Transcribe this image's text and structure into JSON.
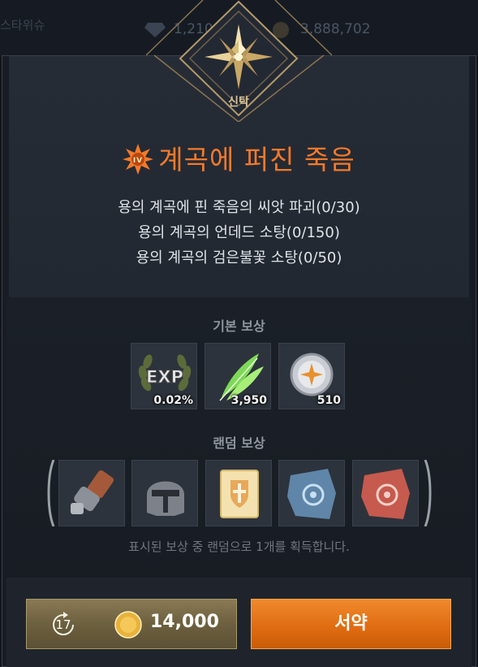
{
  "currency": {
    "left_label": "스타위슈",
    "gems": "1,210",
    "coins": "3,888,702"
  },
  "emblem": {
    "label": "신탁"
  },
  "quest": {
    "title": "계곡에 퍼진 죽음",
    "objectives": [
      "용의 계곡에 핀 죽음의 씨앗 파괴(0/30)",
      "용의 계곡의 언데드 소탕(0/150)",
      "용의 계곡의 검은불꽃 소탕(0/50)"
    ]
  },
  "rewards": {
    "basic_title": "기본 보상",
    "basic_items": [
      {
        "icon": "exp-icon",
        "text": "EXP",
        "qty": "0.02%"
      },
      {
        "icon": "feather-icon",
        "qty": "3,950"
      },
      {
        "icon": "medal-icon",
        "qty": "510"
      }
    ],
    "random_title": "랜덤 보상",
    "random_items": [
      {
        "icon": "gauntlet-icon"
      },
      {
        "icon": "helmet-icon"
      },
      {
        "icon": "scroll-icon"
      },
      {
        "icon": "blue-torn-scroll-icon"
      },
      {
        "icon": "red-torn-scroll-icon"
      }
    ],
    "hint": "표시된 보상 중 랜덤으로 1개를 획득합니다."
  },
  "actions": {
    "refresh_count": "17",
    "cost": "14,000",
    "pledge_label": "서약"
  },
  "colors": {
    "title_orange": "#f47a2a",
    "button_orange": "#e06d12",
    "button_gold": "#6d603f"
  }
}
